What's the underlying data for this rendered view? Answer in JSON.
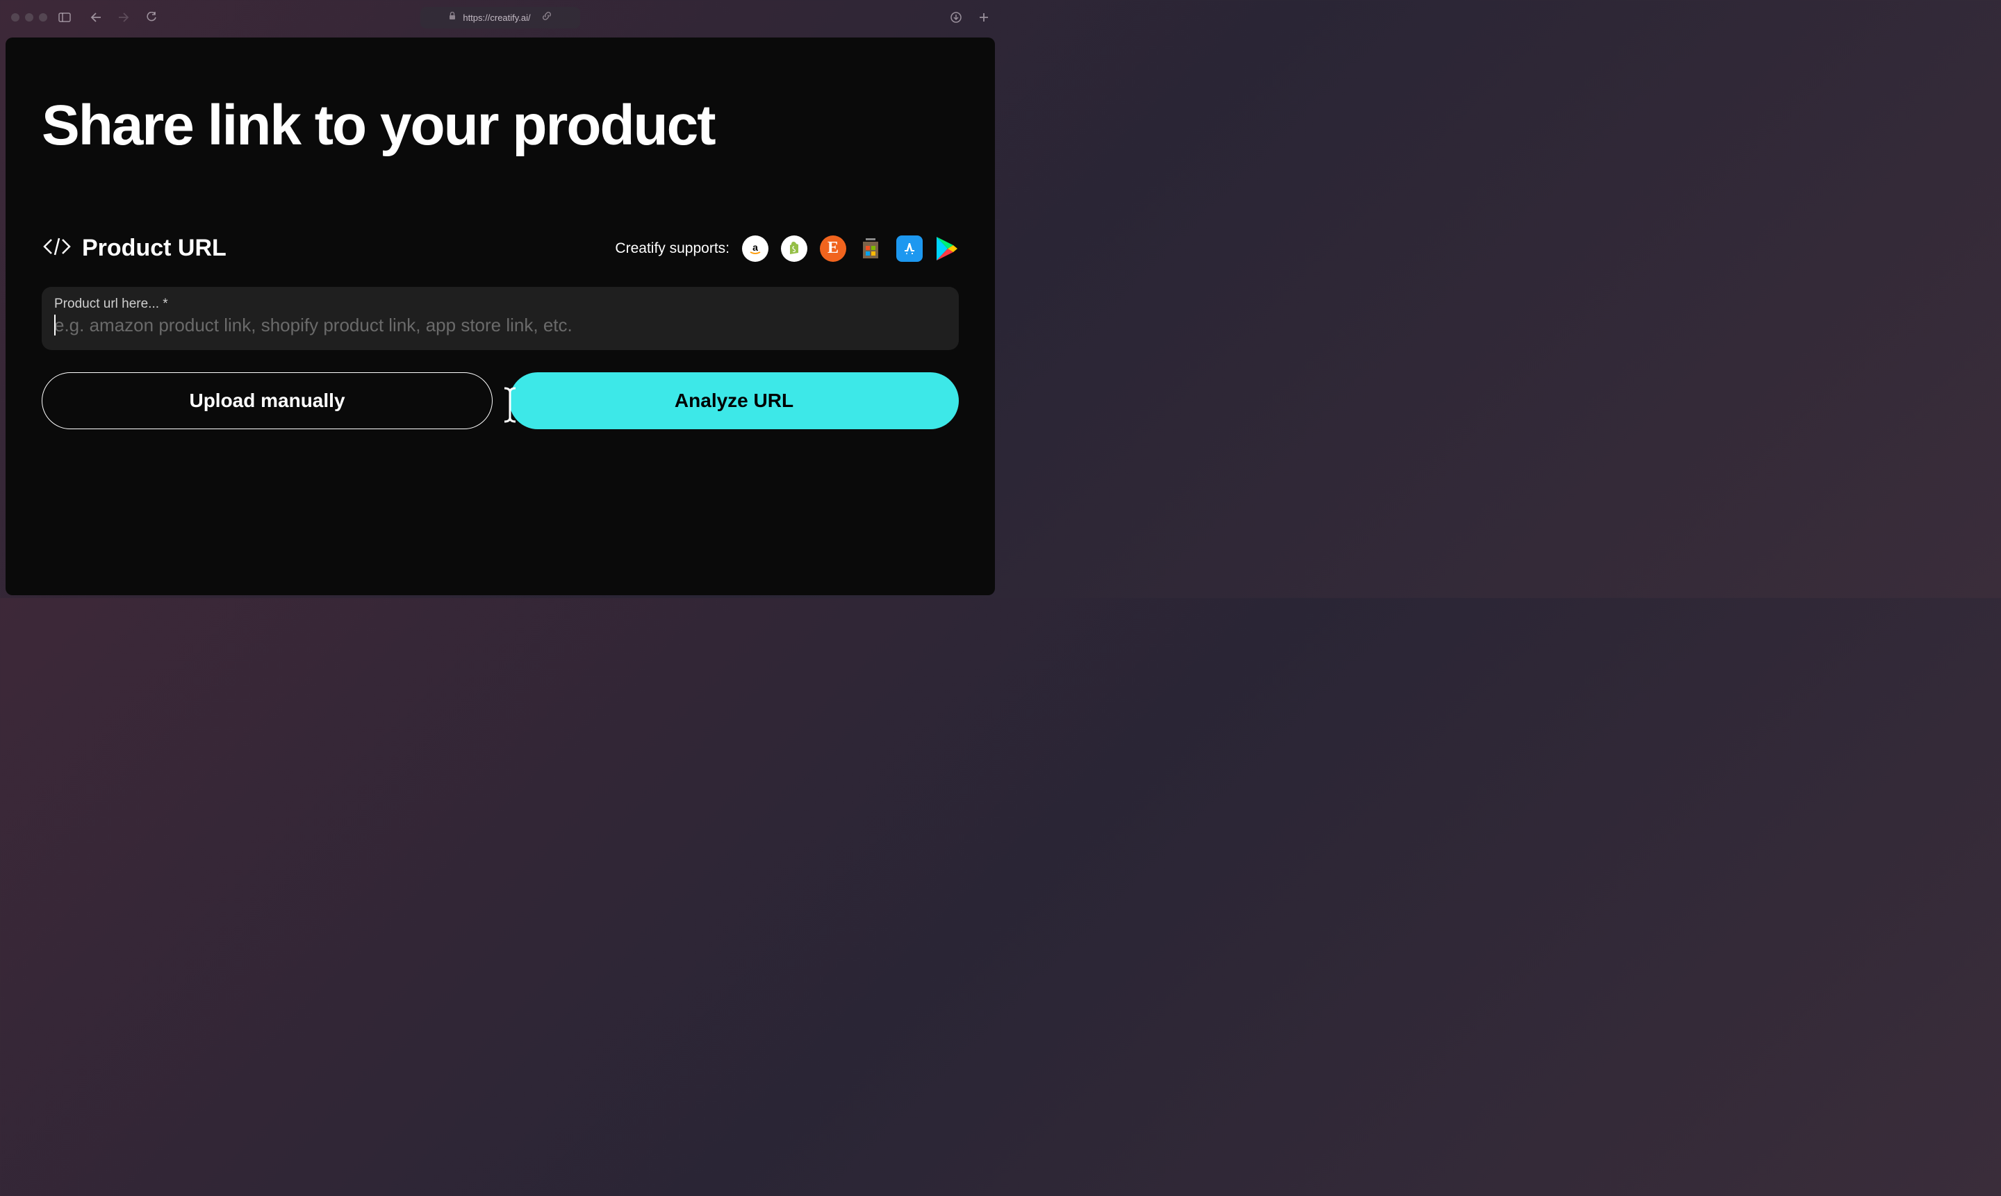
{
  "browser": {
    "url": "https://creatify.ai/"
  },
  "page": {
    "title": "Share link to your product",
    "url_section": {
      "label": "Product URL",
      "supports_label": "Creatify supports:",
      "stores": [
        "amazon",
        "shopify",
        "etsy",
        "microsoft-store",
        "app-store",
        "google-play"
      ]
    },
    "input": {
      "label": "Product url here... *",
      "placeholder": "e.g. amazon product link, shopify product link, app store link, etc.",
      "value": ""
    },
    "buttons": {
      "upload": "Upload manually",
      "analyze": "Analyze URL"
    }
  }
}
